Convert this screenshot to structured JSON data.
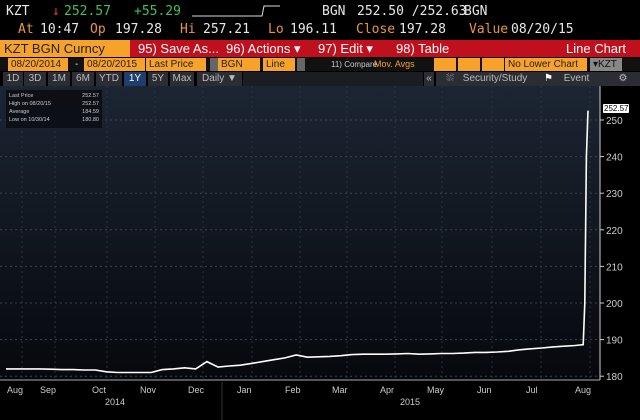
{
  "quote": {
    "ticker": "KZT",
    "direction_icon": "down-arrow",
    "last": "252.57",
    "change": "+55.29",
    "currency": "BGN",
    "bid_ask": "252.50 /252.63",
    "currency2": "BGN",
    "at_label": "At",
    "time": "10:47",
    "open_label": "Op",
    "open": "197.28",
    "high_label": "Hi",
    "high": "257.21",
    "low_label": "Lo",
    "low": "196.11",
    "close_label": "Close",
    "close": "197.28",
    "value_label": "Value",
    "value_date": "08/20/15"
  },
  "toolbar": {
    "security": "KZT BGN Curncy",
    "save_as": "95) Save As...",
    "actions": "96) Actions",
    "edit": "97) Edit",
    "table": "98) Table",
    "chart_type_title": "Line Chart"
  },
  "settings": {
    "start_date": "08/20/2014",
    "dash": "-",
    "end_date": "08/20/2015",
    "field": "Last Price",
    "currency": "BGN",
    "style": "Line",
    "compare": "11) Compare",
    "mov_avgs": "Mov. Avgs",
    "lower_chart": "No Lower Chart",
    "ccy": "KZT"
  },
  "periods": {
    "items": [
      "1D",
      "3D",
      "1M",
      "6M",
      "YTD",
      "1Y",
      "5Y",
      "Max"
    ],
    "active": "1Y",
    "frequency": "Daily ▼",
    "collapse": "«",
    "security_study": "Security/Study",
    "event": "Event"
  },
  "legend": {
    "last_label": "Last Price",
    "last": "252.57",
    "high_label": "High on 08/20/15",
    "high": "252.57",
    "avg_label": "Average",
    "avg": "184.59",
    "low_label": "Low on 10/30/14",
    "low": "180.80"
  },
  "colors": {
    "orange": "#f7a22b",
    "red": "#c0101e",
    "line": "#ffffff",
    "up": "#3fc15a",
    "down": "#e83a3a"
  },
  "chart_data": {
    "type": "line",
    "title": "KZT BGN Curncy",
    "ylim": [
      175,
      255
    ],
    "yticks": [
      180,
      190,
      200,
      210,
      220,
      230,
      240,
      250
    ],
    "xlabels": [
      "Aug",
      "Sep",
      "Oct",
      "Nov",
      "Dec",
      "Jan",
      "Feb",
      "Mar",
      "Apr",
      "May",
      "Jun",
      "Jul",
      "Aug"
    ],
    "years": [
      "2014",
      "2015"
    ],
    "last_value_label": "252.57",
    "series": [
      {
        "name": "Last Price",
        "x_days": [
          0,
          7,
          14,
          21,
          28,
          35,
          42,
          49,
          56,
          63,
          70,
          77,
          84,
          91,
          98,
          105,
          112,
          119,
          126,
          133,
          140,
          147,
          154,
          161,
          168,
          175,
          182,
          189,
          196,
          203,
          210,
          217,
          224,
          231,
          238,
          245,
          252,
          259,
          266,
          273,
          280,
          287,
          294,
          301,
          308,
          315,
          322,
          329,
          336,
          343,
          350,
          357,
          362,
          363,
          364,
          365
        ],
        "values": [
          182,
          182,
          182,
          182,
          181.9,
          181.8,
          181.8,
          181.7,
          181.7,
          181.2,
          181,
          181,
          181,
          181,
          181.8,
          182,
          182.3,
          182,
          184,
          182.5,
          182.8,
          183,
          183.5,
          184,
          184.5,
          185,
          185.8,
          185.2,
          185.3,
          185.4,
          185.6,
          185.9,
          186,
          186,
          186,
          186.1,
          186.2,
          186,
          186.1,
          186.2,
          186.2,
          186.3,
          186.5,
          186.5,
          186.6,
          186.8,
          187.2,
          187.5,
          187.7,
          188,
          188.2,
          188.4,
          188.6,
          200,
          240,
          252.57
        ]
      }
    ]
  }
}
